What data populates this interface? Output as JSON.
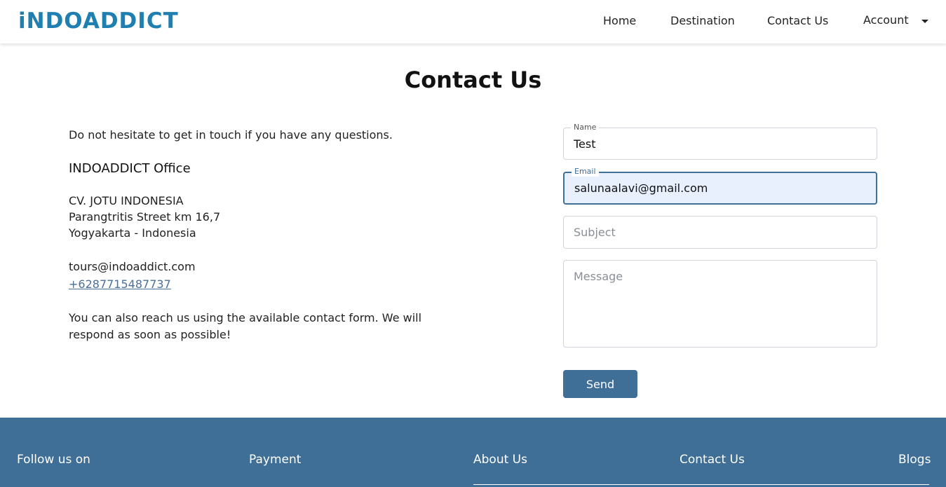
{
  "brand": {
    "logo_text": "iNDOADDICT",
    "color": "#1e7fb0"
  },
  "nav": {
    "home": "Home",
    "destination": "Destination",
    "contact": "Contact Us",
    "account": "Account"
  },
  "page": {
    "title": "Contact Us"
  },
  "info": {
    "intro": "Do not hesitate to get in touch if you have any questions.",
    "office_title": "INDOADDICT Office",
    "address_line1": "CV. JOTU INDONESIA",
    "address_line2": "Parangtritis Street km 16,7",
    "address_line3": "Yogyakarta - Indonesia",
    "email": "tours@indoaddict.com",
    "phone": "+6287715487737",
    "reach": "You can also reach us using the available contact form. We will respond as soon as possible!"
  },
  "form": {
    "name_label": "Name",
    "name_value": "Test",
    "email_label": "Email",
    "email_value": "salunaalavi@gmail.com",
    "subject_placeholder": "Subject",
    "message_placeholder": "Message",
    "send_label": "Send"
  },
  "footer": {
    "follow": "Follow us on",
    "payment": "Payment",
    "about": "About Us",
    "contact": "Contact Us",
    "blogs": "Blogs"
  },
  "colors": {
    "accent": "#3f6e96",
    "link": "#4a6f9a"
  }
}
